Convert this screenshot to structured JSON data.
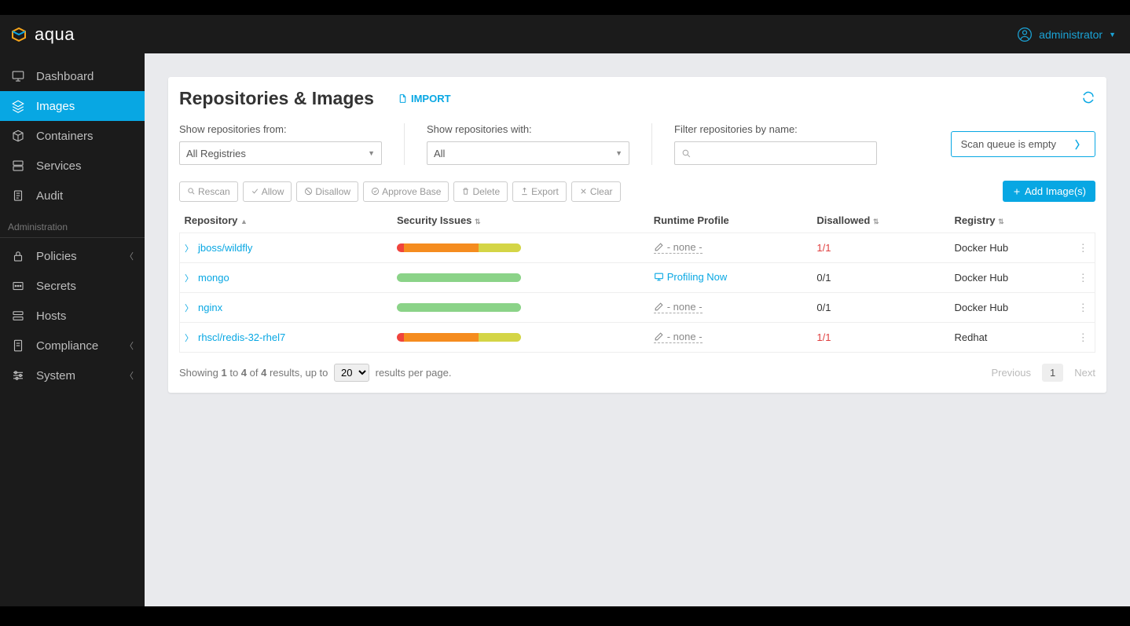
{
  "brand": "aqua",
  "user": {
    "name": "administrator"
  },
  "nav": {
    "items": [
      {
        "label": "Dashboard"
      },
      {
        "label": "Images"
      },
      {
        "label": "Containers"
      },
      {
        "label": "Services"
      },
      {
        "label": "Audit"
      }
    ],
    "admin_header": "Administration",
    "admin_items": [
      {
        "label": "Policies",
        "expandable": true
      },
      {
        "label": "Secrets",
        "expandable": false
      },
      {
        "label": "Hosts",
        "expandable": false
      },
      {
        "label": "Compliance",
        "expandable": true
      },
      {
        "label": "System",
        "expandable": true
      }
    ]
  },
  "page": {
    "title": "Repositories & Images",
    "import_label": "IMPORT"
  },
  "filters": {
    "from_label": "Show repositories from:",
    "from_value": "All Registries",
    "with_label": "Show repositories with:",
    "with_value": "All",
    "name_label": "Filter repositories by name:",
    "scan_queue": "Scan queue is empty"
  },
  "actions": {
    "rescan": "Rescan",
    "allow": "Allow",
    "disallow": "Disallow",
    "approve": "Approve Base",
    "delete": "Delete",
    "export": "Export",
    "clear": "Clear",
    "add": "Add Image(s)"
  },
  "columns": {
    "repo": "Repository",
    "sec": "Security Issues",
    "runtime": "Runtime Profile",
    "disallowed": "Disallowed",
    "registry": "Registry"
  },
  "rows": [
    {
      "repo": "jboss/wildfly",
      "bar": "mixed",
      "profile": "- none -",
      "profile_mode": "none",
      "disallowed": "1/1",
      "disallowed_red": true,
      "registry": "Docker Hub"
    },
    {
      "repo": "mongo",
      "bar": "green",
      "profile": "Profiling Now",
      "profile_mode": "now",
      "disallowed": "0/1",
      "disallowed_red": false,
      "registry": "Docker Hub"
    },
    {
      "repo": "nginx",
      "bar": "green",
      "profile": "- none -",
      "profile_mode": "none",
      "disallowed": "0/1",
      "disallowed_red": false,
      "registry": "Docker Hub"
    },
    {
      "repo": "rhscl/redis-32-rhel7",
      "bar": "mixed",
      "profile": "- none -",
      "profile_mode": "none",
      "disallowed": "1/1",
      "disallowed_red": true,
      "registry": "Redhat"
    }
  ],
  "pager": {
    "showing_prefix": "Showing ",
    "from": "1",
    "to_word": " to ",
    "to": "4",
    "of_word": " of ",
    "total": "4",
    "results_upto": " results, up to ",
    "per_page": "20",
    "suffix": " results per page.",
    "prev": "Previous",
    "current": "1",
    "next": "Next"
  }
}
